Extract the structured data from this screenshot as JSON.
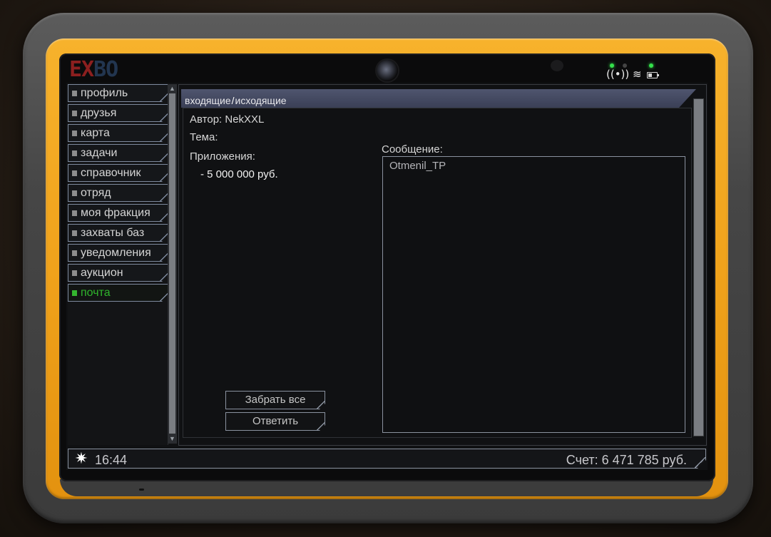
{
  "logo": {
    "part1": "EX",
    "part2": "BO"
  },
  "nav": {
    "items": [
      {
        "label": "профиль",
        "active": false
      },
      {
        "label": "друзья",
        "active": false
      },
      {
        "label": "карта",
        "active": false
      },
      {
        "label": "задачи",
        "active": false
      },
      {
        "label": "справочник",
        "active": false
      },
      {
        "label": "отряд",
        "active": false
      },
      {
        "label": "моя фракция",
        "active": false
      },
      {
        "label": "захваты баз",
        "active": false
      },
      {
        "label": "уведомления",
        "active": false
      },
      {
        "label": "аукцион",
        "active": false
      },
      {
        "label": "почта",
        "active": true
      }
    ]
  },
  "mail": {
    "tab_inbox": "входящие",
    "tab_separator": "/",
    "tab_outbox": "исходящие",
    "author": "Автор: NekXXL",
    "subject": "Тема:",
    "attachments_label": "Приложения:",
    "attachment_item": "- 5 000 000 руб.",
    "message_label": "Сообщение:",
    "message_text": "Otmenil_TP",
    "take_all_button": "Забрать все",
    "reply_button": "Ответить"
  },
  "status": {
    "time": "16:44",
    "balance": "Счет: 6 471 785 руб."
  },
  "icons": {
    "sun": "sun-icon",
    "wifi": "wifi-icon",
    "battery": "battery-icon",
    "camera": "camera-icon"
  },
  "colors": {
    "accent_green": "#2fb52c",
    "frame_yellow": "#f0a21b",
    "tab_bar": "#4a4f68"
  }
}
